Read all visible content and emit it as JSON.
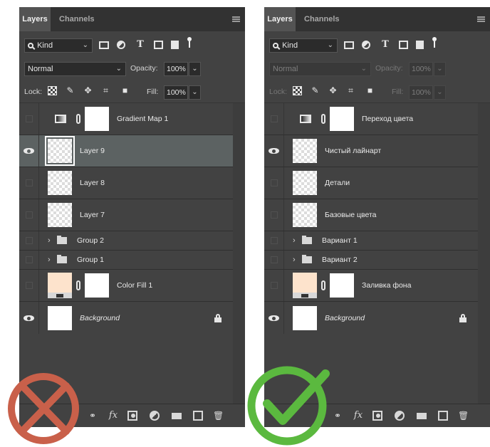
{
  "panels": [
    {
      "id": "left",
      "tabs": {
        "active": "Layers",
        "inactive": "Channels"
      },
      "filter": {
        "kind_label": "Kind"
      },
      "blend": {
        "mode": "Normal",
        "opacity_label": "Opacity:",
        "opacity_value": "100%"
      },
      "lock": {
        "label": "Lock:",
        "fill_label": "Fill:",
        "fill_value": "100%"
      },
      "layers": [
        {
          "name": "Gradient Map 1",
          "type": "adjustment",
          "visible": false
        },
        {
          "name": "Layer 9",
          "type": "pixel",
          "visible": true,
          "selected": true
        },
        {
          "name": "Layer 8",
          "type": "pixel",
          "visible": false
        },
        {
          "name": "Layer 7",
          "type": "pixel",
          "visible": false
        },
        {
          "name": "Group 2",
          "type": "group",
          "visible": false
        },
        {
          "name": "Group 1",
          "type": "group",
          "visible": false
        },
        {
          "name": "Color Fill 1",
          "type": "fill",
          "visible": false
        },
        {
          "name": "Background",
          "type": "background",
          "visible": true,
          "locked": true
        }
      ]
    },
    {
      "id": "right",
      "tabs": {
        "active": "Layers",
        "inactive": "Channels"
      },
      "filter": {
        "kind_label": "Kind"
      },
      "blend": {
        "mode": "Normal",
        "opacity_label": "Opacity:",
        "opacity_value": "100%"
      },
      "lock": {
        "label": "Lock:",
        "fill_label": "Fill:",
        "fill_value": "100%"
      },
      "layers": [
        {
          "name": "Переход цвета",
          "type": "adjustment",
          "visible": false
        },
        {
          "name": "Чистый лайнарт",
          "type": "pixel",
          "visible": true
        },
        {
          "name": "Детали",
          "type": "pixel",
          "visible": false
        },
        {
          "name": "Базовые цвета",
          "type": "pixel",
          "visible": false
        },
        {
          "name": "Вариант 1",
          "type": "group",
          "visible": false
        },
        {
          "name": "Вариант 2",
          "type": "group",
          "visible": false
        },
        {
          "name": "Заливка фона",
          "type": "fill",
          "visible": false
        },
        {
          "name": "Background",
          "type": "background",
          "visible": true,
          "locked": true
        }
      ]
    }
  ],
  "icons": {
    "filter": [
      "search-icon",
      "image-filter-icon",
      "adjustment-filter-icon",
      "type-filter-icon",
      "shape-filter-icon",
      "smart-object-filter-icon",
      "filter-toggle-icon"
    ],
    "lock": [
      "lock-transparent-pixels-icon",
      "lock-image-pixels-icon",
      "lock-position-icon",
      "lock-artboard-icon",
      "lock-all-icon"
    ],
    "bottom": [
      "link-layers-icon",
      "fx-icon",
      "add-mask-icon",
      "adjustment-layer-icon",
      "new-group-icon",
      "new-layer-icon",
      "trash-icon"
    ]
  },
  "marks": {
    "wrong_color": "#c9604a",
    "right_color": "#5bb93f"
  }
}
